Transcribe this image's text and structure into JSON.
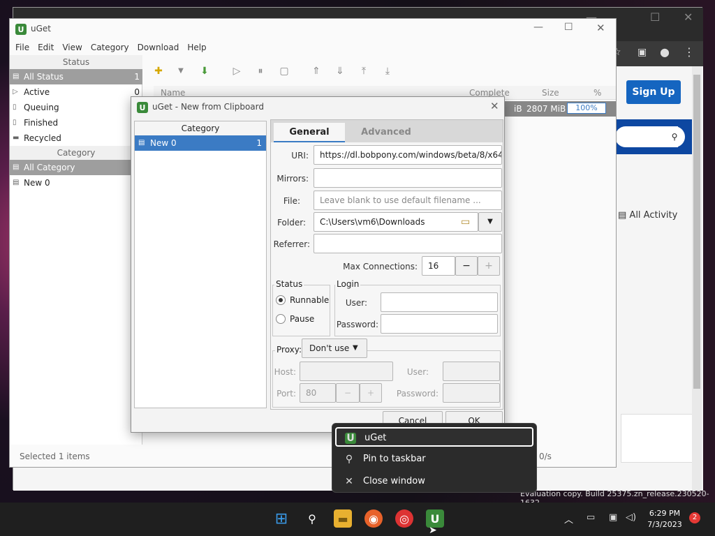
{
  "browser": {
    "signup_label": "Sign Up",
    "all_activity": "All Activity",
    "eval_note": "Evaluation copy. Build 25375.zn_release.230520-1632"
  },
  "main": {
    "title": "uGet",
    "menu": [
      "File",
      "Edit",
      "View",
      "Category",
      "Download",
      "Help"
    ],
    "status_header": "Status",
    "status_items": [
      {
        "label": "All Status",
        "count": "1"
      },
      {
        "label": "Active",
        "count": "0"
      },
      {
        "label": "Queuing",
        "count": ""
      },
      {
        "label": "Finished",
        "count": ""
      },
      {
        "label": "Recycled",
        "count": ""
      }
    ],
    "category_header": "Category",
    "category_items": [
      {
        "label": "All Category"
      },
      {
        "label": "New 0"
      }
    ],
    "list_columns": {
      "name": "Name",
      "complete": "Complete",
      "size": "Size",
      "percent": "%"
    },
    "row": {
      "complete": "iB",
      "size": "2807 MiB",
      "percent": "100%"
    },
    "status_text": "Selected 1 items",
    "speed_text": "0/s"
  },
  "dialog": {
    "title": "uGet - New from Clipboard",
    "category_header": "Category",
    "category_item": "New 0",
    "category_count": "1",
    "tabs": {
      "general": "General",
      "advanced": "Advanced"
    },
    "uri_label": "URI:",
    "uri_value": "https://dl.bobpony.com/windows/beta/8/x64",
    "mirrors_label": "Mirrors:",
    "file_label": "File:",
    "file_placeholder": "Leave blank to use default filename ...",
    "folder_label": "Folder:",
    "folder_value": "C:\\Users\\vm6\\Downloads",
    "referrer_label": "Referrer:",
    "max_conn_label": "Max Connections:",
    "max_conn_value": "16",
    "status_group": "Status",
    "runnable_label": "Runnable",
    "pause_label": "Pause",
    "login_group": "Login",
    "user_label": "User:",
    "password_label": "Password:",
    "proxy_label": "Proxy:",
    "proxy_value": "Don't use",
    "host_label": "Host:",
    "port_label": "Port:",
    "port_value": "80",
    "proxy_user_label": "User:",
    "proxy_password_label": "Password:",
    "cancel_label": "Cancel",
    "ok_label": "OK"
  },
  "context_menu": {
    "items": [
      "uGet",
      "Pin to taskbar",
      "Close window"
    ]
  },
  "taskbar": {
    "time": "6:29 PM",
    "date": "7/3/2023",
    "notifications": "2"
  },
  "colors": {
    "accent": "#3b7bc4",
    "selection_gray": "#9e9e9e",
    "ugetgreen": "#3a8a3a",
    "signup_blue": "#1565c0"
  }
}
